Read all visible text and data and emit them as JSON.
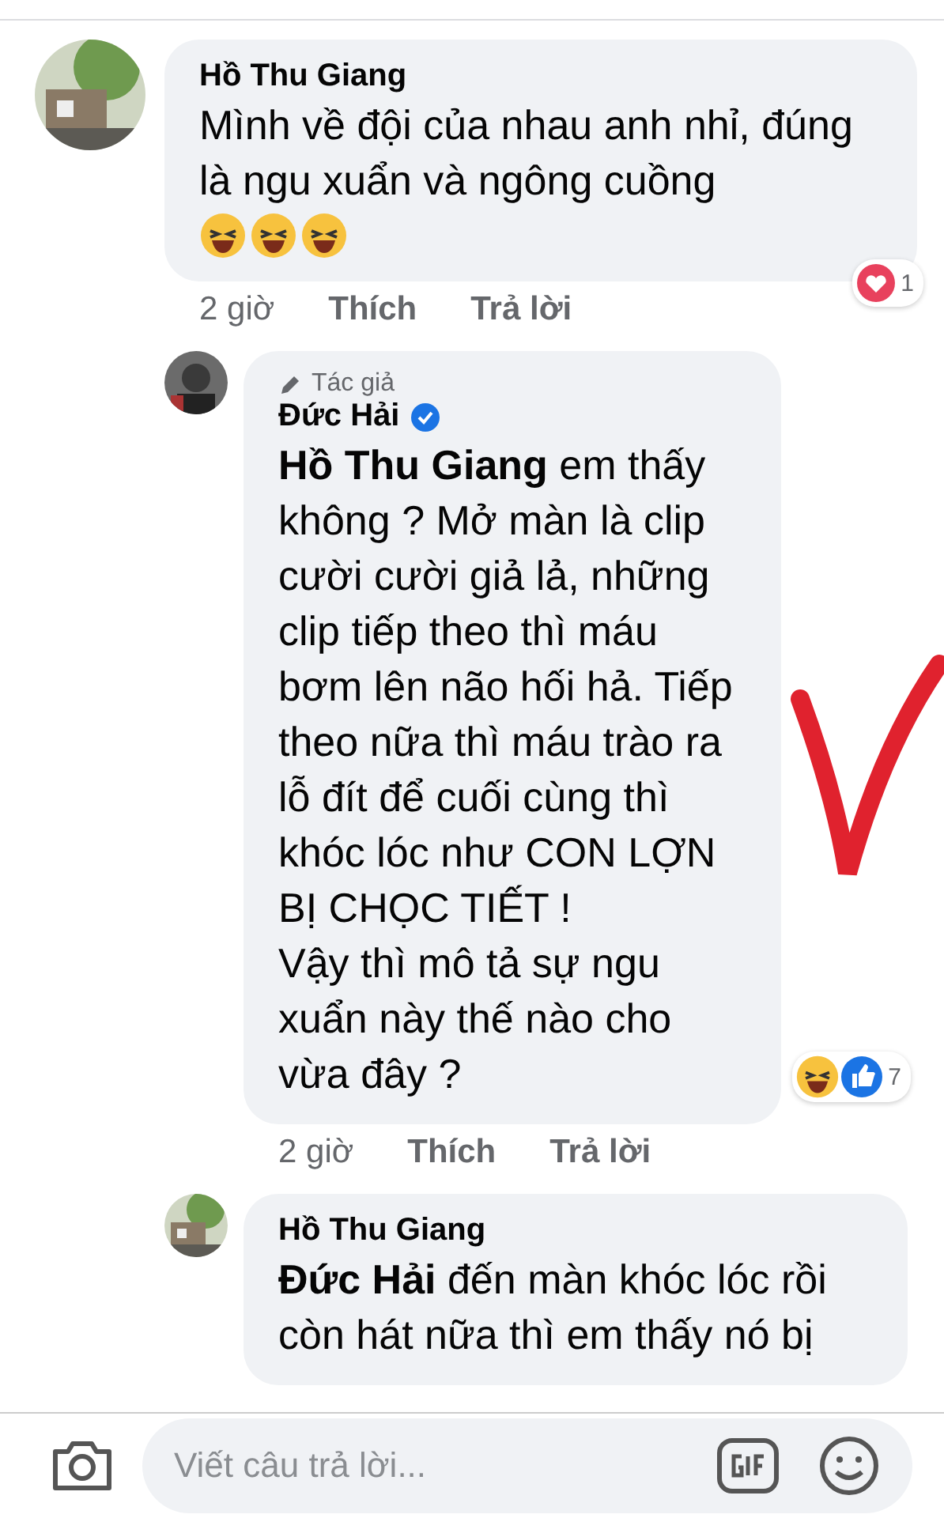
{
  "comments": [
    {
      "author": "Hồ Thu Giang",
      "verified": false,
      "body": "Mình về đội của nhau anh nhỉ, đúng là ngu xuẩn và ngông cuồng",
      "emojis": [
        {
          "kind": "haha"
        },
        {
          "kind": "haha"
        },
        {
          "kind": "haha"
        }
      ],
      "time": "2 giờ",
      "like": "Thích",
      "reply": "Trả lời",
      "reactions": [
        {
          "kind": "love"
        }
      ],
      "reaction_count": "1",
      "replies": [
        {
          "author": "Đức Hải",
          "badge": "Tác giả",
          "verified": true,
          "body": "**Hồ Thu Giang** em thấy không ? Mở màn là clip cười cười giả lả, những clip tiếp theo thì máu bơm lên não hối hả. Tiếp theo nữa thì máu trào ra lỗ đít để cuối cùng thì khóc lóc như CON LỢN BỊ CHỌC TIẾT  !\nVậy thì mô tả sự ngu xuẩn này thế nào cho vừa đây ?",
          "time": "2 giờ",
          "like": "Thích",
          "reply": "Trả lời",
          "reactions": [
            {
              "kind": "haha"
            },
            {
              "kind": "like"
            }
          ],
          "reaction_count": "7"
        },
        {
          "author": "Hồ Thu Giang",
          "verified": false,
          "body": "**Đức Hải** đến màn khóc lóc rồi còn hát nữa thì em thấy nó bị"
        }
      ]
    }
  ],
  "composer": {
    "placeholder": "Viết câu trả lời..."
  }
}
